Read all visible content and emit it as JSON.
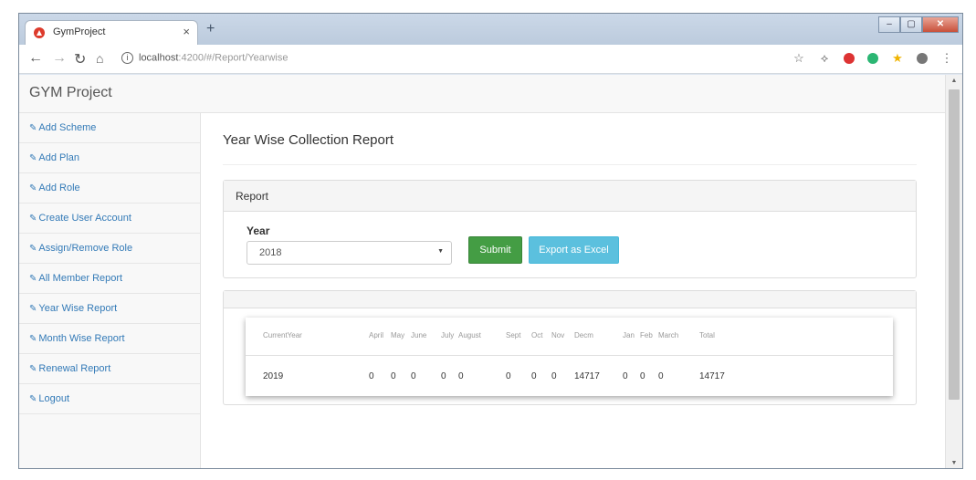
{
  "browser": {
    "tab_title": "GymProject",
    "tab_close": "×",
    "new_tab": "+",
    "url_host": "localhost",
    "url_path": ":4200/#/Report/Yearwise",
    "window_controls": {
      "minimize": "–",
      "maximize": "▢",
      "close": "✕"
    }
  },
  "navbar": {
    "brand": "GYM Project"
  },
  "sidebar": {
    "items": [
      {
        "label": "Add Scheme"
      },
      {
        "label": "Add Plan"
      },
      {
        "label": "Add Role"
      },
      {
        "label": "Create User Account"
      },
      {
        "label": "Assign/Remove Role"
      },
      {
        "label": "All Member Report"
      },
      {
        "label": "Year Wise Report"
      },
      {
        "label": "Month Wise Report"
      },
      {
        "label": "Renewal Report"
      },
      {
        "label": "Logout"
      }
    ]
  },
  "main": {
    "title": "Year Wise Collection Report",
    "report_panel": {
      "heading": "Report",
      "year_label": "Year",
      "year_value": "2018",
      "submit_label": "Submit",
      "export_label": "Export as Excel"
    },
    "table": {
      "headers": [
        "CurrentYear",
        "April",
        "May",
        "June",
        "July",
        "August",
        "Sept",
        "Oct",
        "Nov",
        "Decm",
        "Jan",
        "Feb",
        "March",
        "Total"
      ],
      "rows": [
        [
          "2019",
          "0",
          "0",
          "0",
          "0",
          "0",
          "0",
          "0",
          "0",
          "14717",
          "0",
          "0",
          "0",
          "14717"
        ]
      ]
    }
  },
  "colors": {
    "link": "#337ab7",
    "submit_button": "#449d44",
    "excel_button": "#5bc0de",
    "favicon": "#dd3b2c"
  },
  "icons": {
    "sidebar_item": "edit-icon",
    "tab_favicon": "angular-icon",
    "omnibox": "info-icon",
    "toolbar": [
      "back-icon",
      "forward-icon",
      "reload-icon",
      "home-icon",
      "star-icon",
      "extension-icon",
      "shield-icon",
      "grammarly-icon",
      "bookmark-star-icon",
      "profile-icon",
      "menu-icon"
    ]
  }
}
